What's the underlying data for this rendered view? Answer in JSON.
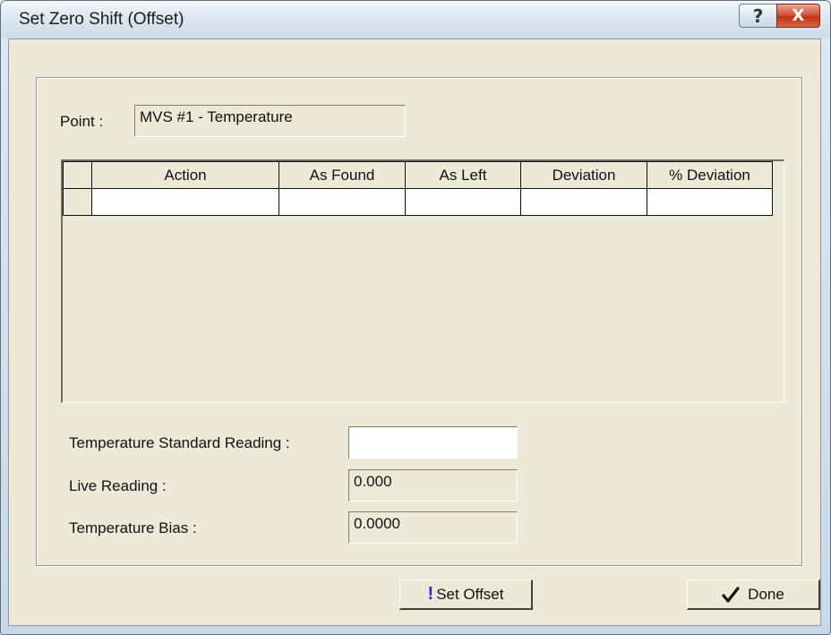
{
  "window": {
    "title": "Set Zero Shift (Offset)",
    "help_glyph": "?",
    "close_glyph": "X"
  },
  "point": {
    "label": "Point :",
    "value": "MVS #1 - Temperature"
  },
  "grid": {
    "columns": [
      "",
      "Action",
      "As Found",
      "As Left",
      "Deviation",
      "% Deviation"
    ],
    "rows": [
      [
        "",
        "",
        "",
        "",
        "",
        ""
      ]
    ]
  },
  "fields": {
    "standard_reading": {
      "label": "Temperature Standard Reading :",
      "value": ""
    },
    "live_reading": {
      "label": "Live Reading :",
      "value": "0.000"
    },
    "temperature_bias": {
      "label": "Temperature Bias :",
      "value": "0.0000"
    }
  },
  "buttons": {
    "set_offset": {
      "label": "Set Offset",
      "icon": "exclamation-icon"
    },
    "done": {
      "label": "Done",
      "icon": "checkmark-icon"
    }
  },
  "colors": {
    "dialog_face": "#ece9d8",
    "close_button": "#c9472c",
    "exclamation": "#1f2bd8"
  }
}
